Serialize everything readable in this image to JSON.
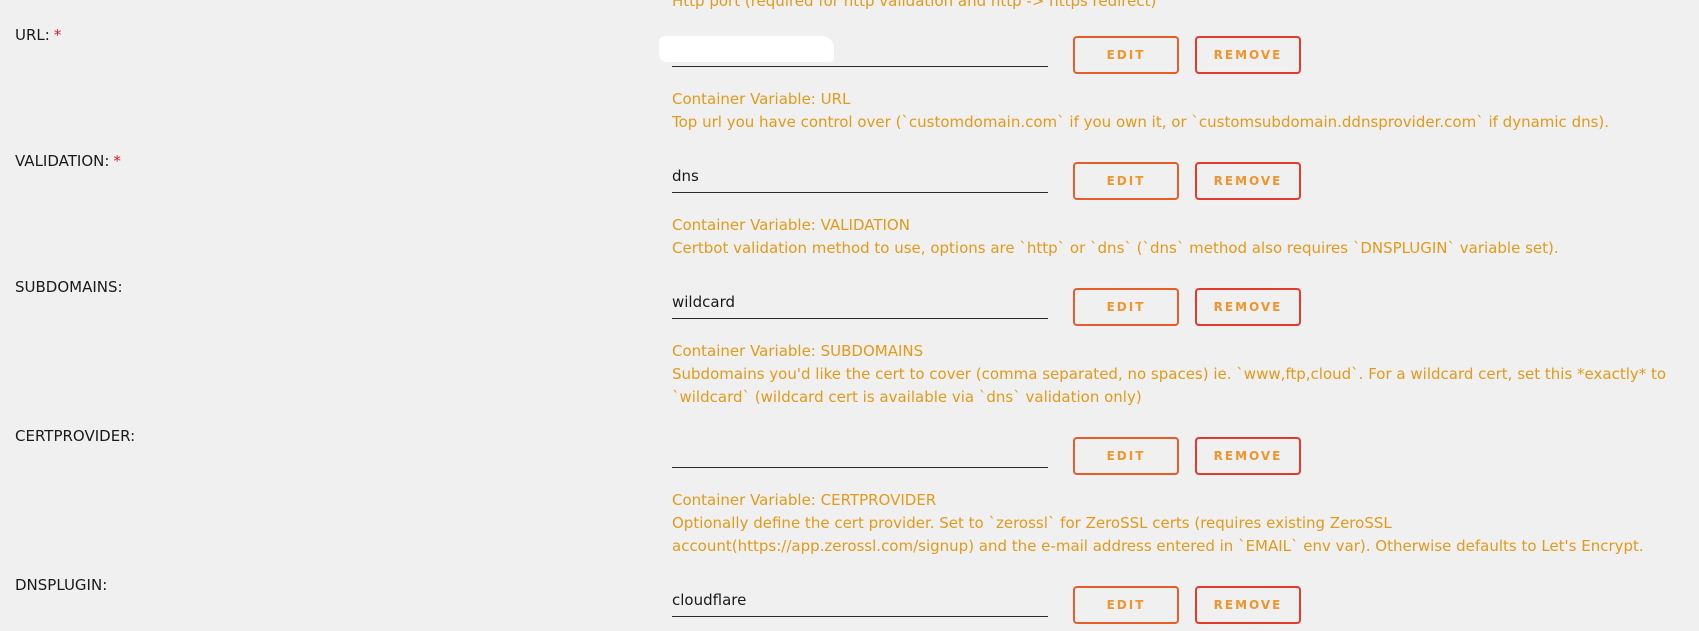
{
  "top_note": "Http port (required for http validation and http -> https redirect)",
  "buttons": {
    "edit": "EDIT",
    "remove": "REMOVE"
  },
  "required_marker": "*",
  "variables": [
    {
      "label": "URL:",
      "required": true,
      "value": "",
      "redacted": true,
      "container_variable": "Container Variable: URL",
      "description": "Top url you have control over (`customdomain.com` if you own it, or `customsubdomain.ddnsprovider.com` if dynamic dns)."
    },
    {
      "label": "VALIDATION:",
      "required": true,
      "value": "dns",
      "container_variable": "Container Variable: VALIDATION",
      "description": "Certbot validation method to use, options are `http` or `dns` (`dns` method also requires `DNSPLUGIN` variable set)."
    },
    {
      "label": "SUBDOMAINS:",
      "required": false,
      "value": "wildcard",
      "container_variable": "Container Variable: SUBDOMAINS",
      "description": "Subdomains you'd like the cert to cover (comma separated, no spaces) ie. `www,ftp,cloud`. For a wildcard cert, set this *exactly* to `wildcard` (wildcard cert is available via `dns` validation only)"
    },
    {
      "label": "CERTPROVIDER:",
      "required": false,
      "value": "",
      "container_variable": "Container Variable: CERTPROVIDER",
      "description": "Optionally define the cert provider. Set to `zerossl` for ZeroSSL certs (requires existing ZeroSSL account(https://app.zerossl.com/signup) and the e-mail address entered in `EMAIL` env var). Otherwise defaults to Let's Encrypt."
    },
    {
      "label": "DNSPLUGIN:",
      "required": false,
      "value": "cloudflare",
      "container_variable": "",
      "description": ""
    }
  ],
  "colors": {
    "background": "#f0f0f0",
    "description_text": "#e29a1a",
    "button_border": "#e65d2a",
    "button_text": "#f0952c",
    "required_star": "#e01b1b"
  }
}
